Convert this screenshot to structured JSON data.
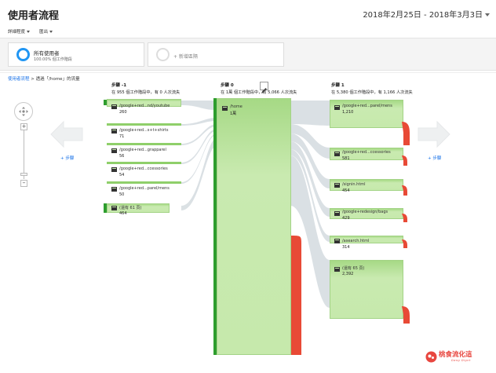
{
  "header": {
    "title": "使用者流程",
    "date_range": "2018年2月25日 - 2018年3月3日"
  },
  "toolbar": {
    "detail_level": "詳細程度",
    "export": "匯出"
  },
  "segments": {
    "primary_name": "所有使用者",
    "primary_sub": "100.00% 個工作階段",
    "add_segment": "+ 新增區隔"
  },
  "breadcrumb": {
    "link": "使用者流程",
    "separator": " > ",
    "current": "透過「/home」的流量"
  },
  "zoom": {
    "plus": "+",
    "minus": "–"
  },
  "add_step_left": "+ 步驟",
  "add_step_right": "+ 步驟",
  "steps": [
    {
      "title": "步驟 -1",
      "summary": "在 955 個工作階段中，有 0 人次流失"
    },
    {
      "title": "步驟 0",
      "summary": "在 1萬 個工作階段中，有 5,066 人次流失"
    },
    {
      "title": "步驟 1",
      "summary": "在 5,380 個工作階段中，有 1,166 人次流失"
    }
  ],
  "step_minus1_nodes": [
    {
      "label": "/google+red...nd/youtube",
      "value": "260"
    },
    {
      "label": "/google+red...s+t+shirts",
      "value": "71"
    },
    {
      "label": "/google+red...grapparel",
      "value": "56"
    },
    {
      "label": "/google+red...ccessories",
      "value": "54"
    },
    {
      "label": "/google+red...parel/mens",
      "value": "50"
    },
    {
      "label": "(還有 61 頁)",
      "value": "464"
    }
  ],
  "step0_node": {
    "label": "/home",
    "value": "1萬"
  },
  "step1_nodes": [
    {
      "label": "/google+red...parel/mens",
      "value": "1,210"
    },
    {
      "label": "/google+red...ccessories",
      "value": "581"
    },
    {
      "label": "/signin.html",
      "value": "454"
    },
    {
      "label": "/google+redesign/bags",
      "value": "429"
    },
    {
      "label": "/asearch.html",
      "value": "314"
    },
    {
      "label": "(還有 65 頁)",
      "value": "2,392"
    }
  ],
  "watermark": {
    "text": "桃食流化這",
    "sub": "Dang Dignt"
  },
  "icons": {
    "zoom_knob": "drag-pan-icon",
    "node_icon": "page-icon",
    "edit": "pencil-icon",
    "arrow_left": "arrow-left-icon",
    "arrow_right": "arrow-right-icon"
  },
  "colors": {
    "node_green": "#c6e9ac",
    "node_dark_green": "#2e9d2e",
    "dropoff_red": "#e84a36",
    "flow_gray": "#d9dfe3",
    "link_blue": "#1a73e8",
    "segment_ring": "#2196f3"
  }
}
